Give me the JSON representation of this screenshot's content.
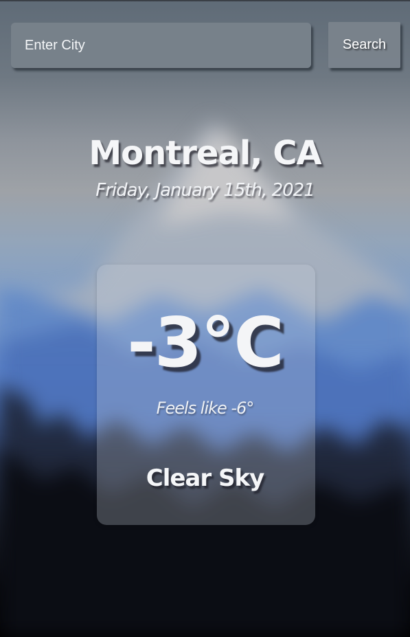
{
  "search": {
    "placeholder": "Enter City",
    "button_label": "Search"
  },
  "location": {
    "city": "Montreal, CA",
    "date": "Friday, January 15th, 2021"
  },
  "weather": {
    "temperature": "-3°C",
    "feels_like": "Feels like -6°",
    "condition": "Clear Sky"
  },
  "background": {
    "description_colors": {
      "sky": "#6e7882",
      "mountain_snow": "#a4acb7",
      "mountain_blue": "#4a6fb4",
      "forest": "#0a0c12"
    }
  }
}
